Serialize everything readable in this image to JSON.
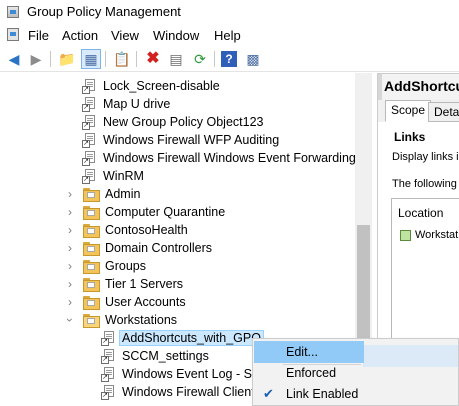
{
  "window": {
    "title": "Group Policy Management"
  },
  "menu": [
    "File",
    "Action",
    "View",
    "Window",
    "Help"
  ],
  "toolbar": {
    "icons": [
      "back-arrow-icon",
      "forward-arrow-icon",
      "up-folder-icon",
      "show-hide-tree-icon",
      "properties-icon",
      "delete-icon",
      "export-icon",
      "refresh-icon",
      "help-icon",
      "console-icon"
    ]
  },
  "tree": {
    "gpos_top": [
      "Lock_Screen-disable",
      "Map U drive",
      "New Group Policy Object123",
      "Windows Firewall WFP Auditing",
      "Windows Firewall Windows Event Forwarding (W",
      "WinRM"
    ],
    "ous": [
      "Admin",
      "Computer Quarantine",
      "ContosoHealth",
      "Domain Controllers",
      "Groups",
      "Tier 1 Servers",
      "User Accounts"
    ],
    "expanded_ou": "Workstations",
    "workstation_links": [
      "AddShortcuts_with_GPO",
      "SCCM_settings",
      "Windows Event Log - Se",
      "Windows Firewall Client"
    ]
  },
  "right_pane": {
    "title": "AddShortcut",
    "tabs": [
      "Scope",
      "Detai"
    ],
    "section": "Links",
    "display_text": "Display links in",
    "following_text": "The following s",
    "column": "Location",
    "item": "Workstati"
  },
  "context_menu": {
    "items": [
      {
        "label": "Edit...",
        "checked": false
      },
      {
        "label": "Enforced",
        "checked": false
      },
      {
        "label": "Link Enabled",
        "checked": true
      }
    ]
  }
}
